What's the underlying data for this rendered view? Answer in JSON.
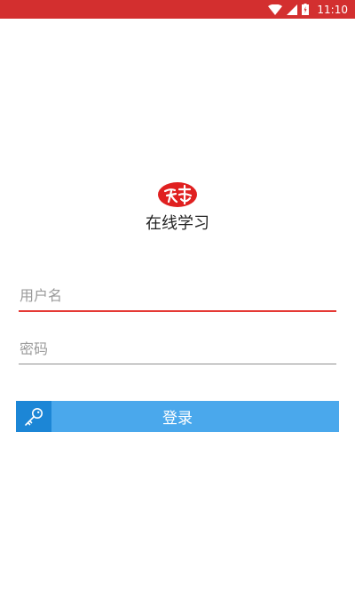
{
  "status_bar": {
    "time": "11:10",
    "icons": [
      "wifi-icon",
      "signal-icon",
      "battery-charging-icon"
    ],
    "color": "#d32f2f"
  },
  "app": {
    "title": "在线学习",
    "logo_icon": "brand-logo-icon",
    "logo_color": "#e02020"
  },
  "login_form": {
    "username_placeholder": "用户名",
    "username_value": "",
    "password_placeholder": "密码",
    "password_value": "",
    "login_label": "登录",
    "login_icon": "key-icon",
    "accent_color": "#e53935",
    "button_color": "#4aa8ec",
    "button_icon_bg": "#1c86d6"
  }
}
